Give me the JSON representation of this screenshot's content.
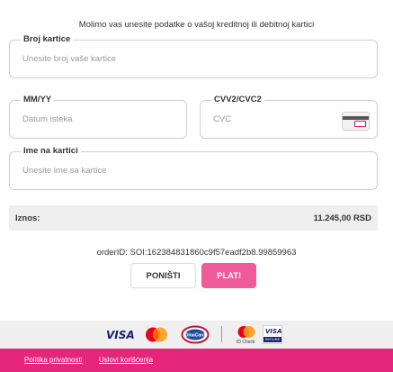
{
  "intro": "Molimo vas unesite podatke o vašoj kreditnoj ili debitnoj kartici",
  "card_number": {
    "label": "Broj kartice",
    "placeholder": "Unesite broj vaše kartice",
    "value": ""
  },
  "expiry": {
    "label": "MM/YY",
    "placeholder": "Datum isteka",
    "value": ""
  },
  "cvc": {
    "label": "CVV2/CVC2",
    "placeholder": "CVC",
    "value": "",
    "icon": "card-cvc-icon"
  },
  "cardholder": {
    "label": "Ime na kartici",
    "placeholder": "Unesite ime sa kartice",
    "value": ""
  },
  "amount": {
    "label": "Iznos:",
    "value": "11.245,00 RSD"
  },
  "order_id": "orderID: SOI:162384831860c9f57eadf2b8.99859963",
  "buttons": {
    "cancel": "PONIŠTI",
    "pay": "PLATI"
  },
  "logos": {
    "visa_1": "VISA",
    "mastercard": "mastercard-logo",
    "dinacard": "DinaCard",
    "mastercard_idcheck": "ID Check",
    "visa_2": "VISA",
    "visa_secure": "SECURE"
  },
  "footer": {
    "privacy": "Politika privatnosti",
    "terms": "Uslovi korišćenja"
  },
  "colors": {
    "accent": "#e4277b",
    "pay_button": "#ef5a9b",
    "visa_blue": "#1a1f71"
  }
}
